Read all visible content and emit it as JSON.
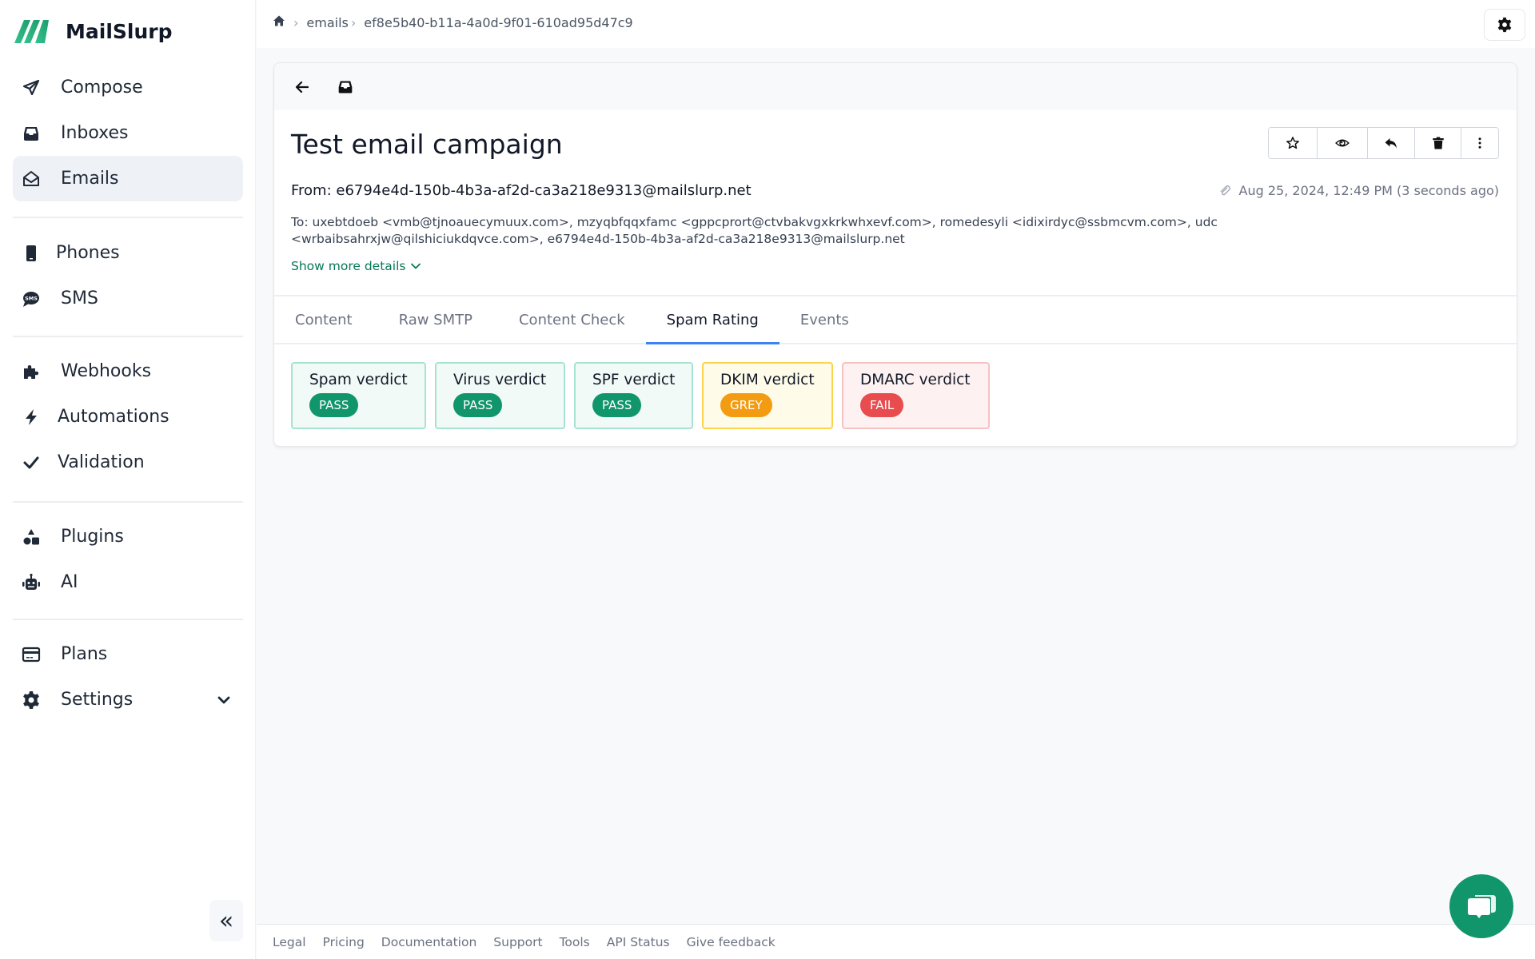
{
  "app": {
    "name": "MailSlurp",
    "brand_color": "#11966b"
  },
  "sidebar": {
    "groups": [
      [
        {
          "label": "Compose",
          "icon": "paper-plane-icon",
          "active": false
        },
        {
          "label": "Inboxes",
          "icon": "inbox-icon",
          "active": false
        },
        {
          "label": "Emails",
          "icon": "envelope-open-icon",
          "active": true
        }
      ],
      [
        {
          "label": "Phones",
          "icon": "phone-icon",
          "active": false
        },
        {
          "label": "SMS",
          "icon": "sms-icon",
          "active": false
        }
      ],
      [
        {
          "label": "Webhooks",
          "icon": "puzzle-icon",
          "active": false
        },
        {
          "label": "Automations",
          "icon": "bolt-icon",
          "active": false
        },
        {
          "label": "Validation",
          "icon": "check-icon",
          "active": false
        }
      ],
      [
        {
          "label": "Plugins",
          "icon": "shapes-icon",
          "active": false
        },
        {
          "label": "AI",
          "icon": "robot-icon",
          "active": false
        }
      ],
      [
        {
          "label": "Plans",
          "icon": "credit-card-icon",
          "active": false
        },
        {
          "label": "Settings",
          "icon": "gear-icon",
          "active": false,
          "expandable": true
        }
      ]
    ],
    "collapse_label": "«"
  },
  "breadcrumb": {
    "items": [
      "emails",
      "ef8e5b40-b11a-4a0d-9f01-610ad95d47c9"
    ]
  },
  "email": {
    "subject": "Test email campaign",
    "from": "From: e6794e4d-150b-4b3a-af2d-ca3a218e9313@mailslurp.net",
    "date": "Aug 25, 2024, 12:49 PM (3 seconds ago)",
    "to": "To: uxebtdoeb <vmb@tjnoauecymuux.com>, mzyqbfqqxfamc <gppcprort@ctvbakvgxkrkwhxevf.com>, romedesyli <idixirdyc@ssbmcvm.com>, udc <wrbaibsahrxjw@qilshiciukdqvce.com>, e6794e4d-150b-4b3a-af2d-ca3a218e9313@mailslurp.net",
    "show_more": "Show more details"
  },
  "actions": [
    "star",
    "view",
    "reply",
    "delete",
    "more"
  ],
  "tabs": [
    {
      "label": "Content",
      "active": false
    },
    {
      "label": "Raw SMTP",
      "active": false
    },
    {
      "label": "Content Check",
      "active": false
    },
    {
      "label": "Spam Rating",
      "active": true
    },
    {
      "label": "Events",
      "active": false
    }
  ],
  "verdicts": [
    {
      "label": "Spam verdict",
      "status": "PASS",
      "border": "#a7e3d2",
      "bg": "#f1faf7",
      "badge": "#11966b"
    },
    {
      "label": "Virus verdict",
      "status": "PASS",
      "border": "#a7e3d2",
      "bg": "#f1faf7",
      "badge": "#11966b"
    },
    {
      "label": "SPF verdict",
      "status": "PASS",
      "border": "#a7e3d2",
      "bg": "#f1faf7",
      "badge": "#11966b"
    },
    {
      "label": "DKIM verdict",
      "status": "GREY",
      "border": "#fcd34d",
      "bg": "#fefce8",
      "badge": "#f39c12"
    },
    {
      "label": "DMARC verdict",
      "status": "FAIL",
      "border": "#f5c2c2",
      "bg": "#fdf1f1",
      "badge": "#e84c4f"
    }
  ],
  "footer": {
    "links": [
      "Legal",
      "Pricing",
      "Documentation",
      "Support",
      "Tools",
      "API Status",
      "Give feedback"
    ]
  }
}
